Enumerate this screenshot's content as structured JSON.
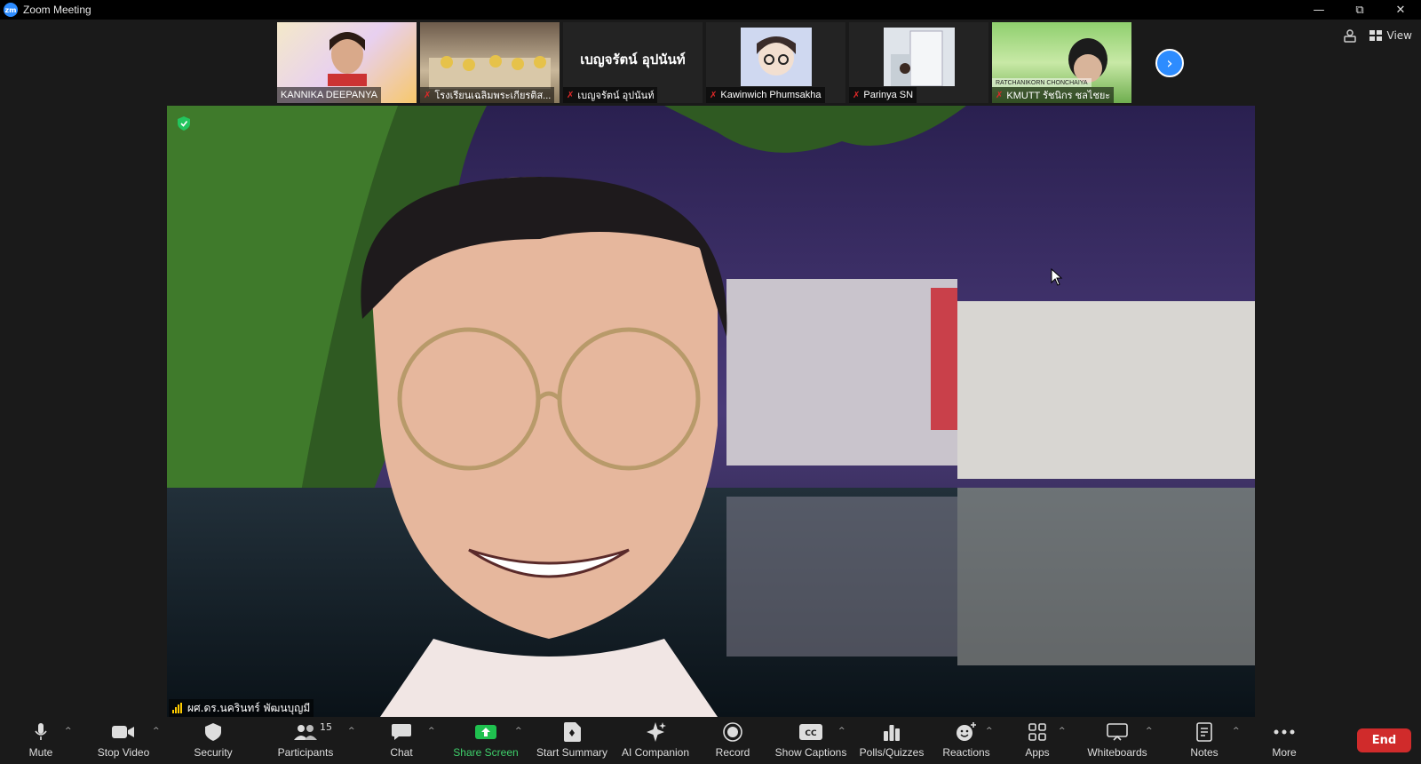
{
  "window": {
    "title": "Zoom Meeting",
    "logo_text": "zm",
    "controls": [
      "minimize",
      "restore",
      "close"
    ]
  },
  "thumbnails": [
    {
      "name": "KANNIKA DEEPANYA",
      "muted": false,
      "type": "video"
    },
    {
      "name": "โรงเรียนเฉลิมพระเกียรติส...",
      "muted": true,
      "type": "video"
    },
    {
      "name": "เบญจรัตน์ อุปนันท์",
      "muted": true,
      "type": "name",
      "display_name": "เบญจรัตน์ อุปนันท์"
    },
    {
      "name": "Kawinwich Phumsakha",
      "muted": true,
      "type": "avatar"
    },
    {
      "name": "Parinya SN",
      "muted": true,
      "type": "avatar"
    },
    {
      "name": "KMUTT รัชนิกร ชลไชยะ",
      "muted": true,
      "type": "video",
      "overlay": "RATCHANIKORN CHONCHAIYA"
    }
  ],
  "top_right": {
    "view_label": "View"
  },
  "main_video": {
    "speaker_name": "ผศ.ดร.นครินทร์ พัฒนบุญมี"
  },
  "toolbar": {
    "mute": "Mute",
    "stop_video": "Stop Video",
    "security": "Security",
    "participants": "Participants",
    "participants_count": "15",
    "chat": "Chat",
    "share_screen": "Share Screen",
    "start_summary": "Start Summary",
    "ai_companion": "AI Companion",
    "record": "Record",
    "show_captions": "Show Captions",
    "polls": "Polls/Quizzes",
    "reactions": "Reactions",
    "apps": "Apps",
    "whiteboards": "Whiteboards",
    "notes": "Notes",
    "more": "More",
    "end": "End"
  },
  "colors": {
    "accent": "#2d8cff",
    "end": "#d02b2b",
    "share": "#1fc14f",
    "muted": "#e02828"
  }
}
